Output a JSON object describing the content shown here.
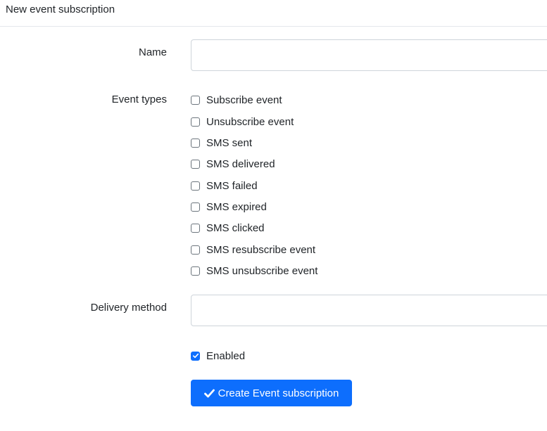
{
  "header": {
    "title": "New event subscription"
  },
  "form": {
    "name_label": "Name",
    "name_value": "",
    "event_types_label": "Event types",
    "event_types": [
      {
        "label": "Subscribe event",
        "checked": false
      },
      {
        "label": "Unsubscribe event",
        "checked": false
      },
      {
        "label": "SMS sent",
        "checked": false
      },
      {
        "label": "SMS delivered",
        "checked": false
      },
      {
        "label": "SMS failed",
        "checked": false
      },
      {
        "label": "SMS expired",
        "checked": false
      },
      {
        "label": "SMS clicked",
        "checked": false
      },
      {
        "label": "SMS resubscribe event",
        "checked": false
      },
      {
        "label": "SMS unsubscribe event",
        "checked": false
      }
    ],
    "delivery_method_label": "Delivery method",
    "delivery_method_value": "",
    "enabled_label": "Enabled",
    "enabled_checked": true,
    "submit_label": "Create Event subscription",
    "submit_icon": "check-icon"
  },
  "colors": {
    "primary": "#0d6efd",
    "border": "#ced4da",
    "text": "#212529"
  }
}
